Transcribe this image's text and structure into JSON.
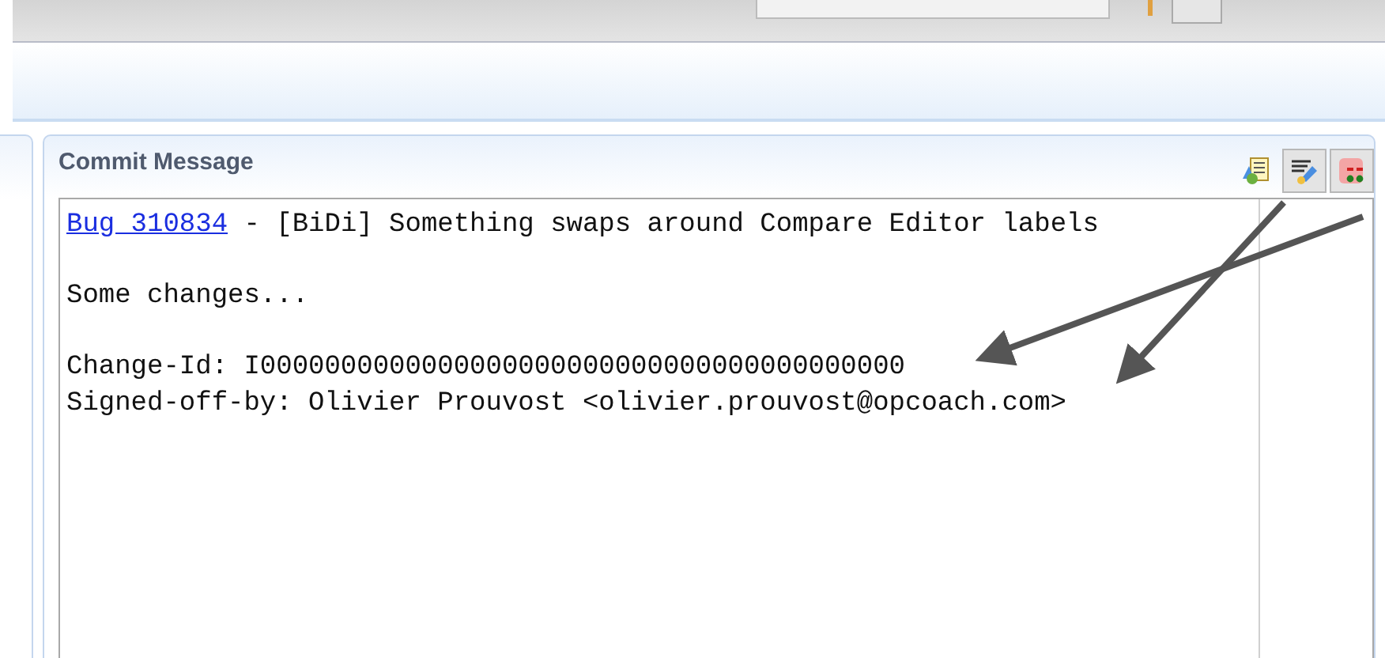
{
  "panel": {
    "title": "Commit Message"
  },
  "toolbar": [
    {
      "kind": "signed-off",
      "pressed": false
    },
    {
      "kind": "change-id",
      "pressed": true
    },
    {
      "kind": "amend",
      "pressed": true
    }
  ],
  "message": {
    "paragraphs": [
      {
        "lines": [
          {
            "link": "Bug 310834",
            "text": " - [BiDi] Something swaps around Compare Editor labels"
          }
        ]
      },
      {
        "lines": [
          {
            "text": "Some changes..."
          }
        ]
      },
      {
        "lines": [
          {
            "text": "Change-Id: I0000000000000000000000000000000000000000"
          },
          {
            "text": "Signed-off-by: Olivier Prouvost <olivier.prouvost@opcoach.com>"
          }
        ]
      }
    ]
  }
}
